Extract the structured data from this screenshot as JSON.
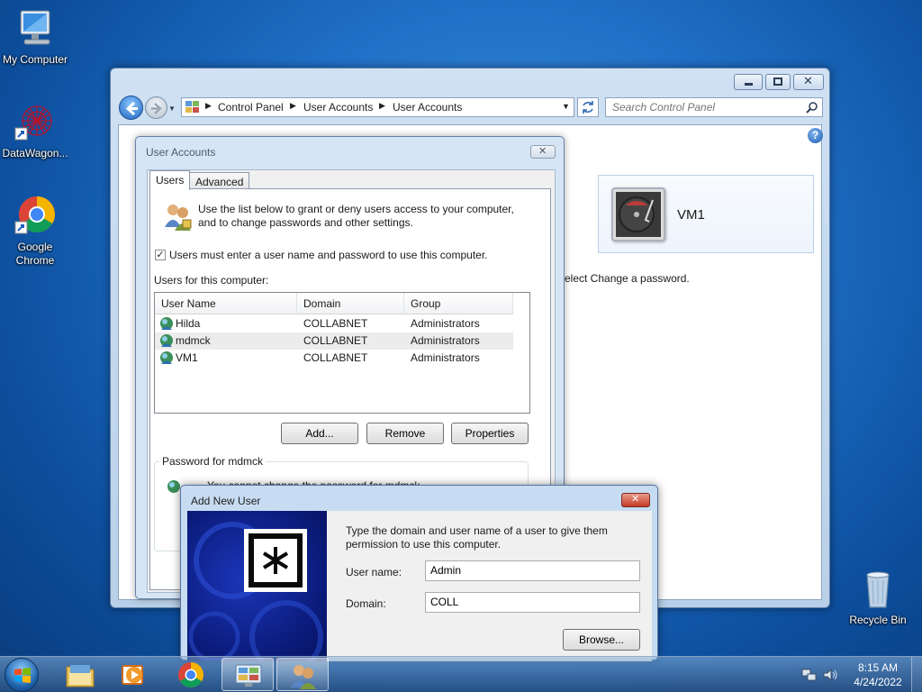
{
  "desktop": {
    "icons": [
      {
        "label": "My Computer"
      },
      {
        "label": "DataWagon..."
      },
      {
        "label": "Google Chrome"
      },
      {
        "label": "Recycle Bin"
      }
    ]
  },
  "control_panel": {
    "breadcrumb": [
      "Control Panel",
      "User Accounts",
      "User Accounts"
    ],
    "search_placeholder": "Search Control Panel",
    "user_tile_name": "VM1",
    "partial_instruction": "elect Change a password."
  },
  "user_accounts_dialog": {
    "title": "User Accounts",
    "tabs": [
      {
        "label": "Users"
      },
      {
        "label": "Advanced"
      }
    ],
    "intro_line1": "Use the list below to grant or deny users access to your computer,",
    "intro_line2": "and to change passwords and other settings.",
    "require_password_label": "Users must enter a user name and password to use this computer.",
    "require_password_checked": true,
    "users_label": "Users for this computer:",
    "columns": [
      "User Name",
      "Domain",
      "Group"
    ],
    "users": [
      {
        "name": "Hilda",
        "domain": "COLLABNET",
        "group": "Administrators"
      },
      {
        "name": "mdmck",
        "domain": "COLLABNET",
        "group": "Administrators"
      },
      {
        "name": "VM1",
        "domain": "COLLABNET",
        "group": "Administrators"
      }
    ],
    "buttons": {
      "add": "Add...",
      "remove": "Remove",
      "properties": "Properties"
    },
    "password_group_label": "Password for mdmck",
    "password_text_partial": "You cannot change the password for mdmck"
  },
  "add_new_user_dialog": {
    "title": "Add New User",
    "instruction_line1": "Type the domain and user name of a user to give them",
    "instruction_line2": "permission to use this computer.",
    "username_label": "User name:",
    "username_value": "Admin",
    "domain_label": "Domain:",
    "domain_value": "COLL",
    "browse_label": "Browse..."
  },
  "taskbar": {
    "time": "8:15 AM",
    "date": "4/24/2022"
  }
}
